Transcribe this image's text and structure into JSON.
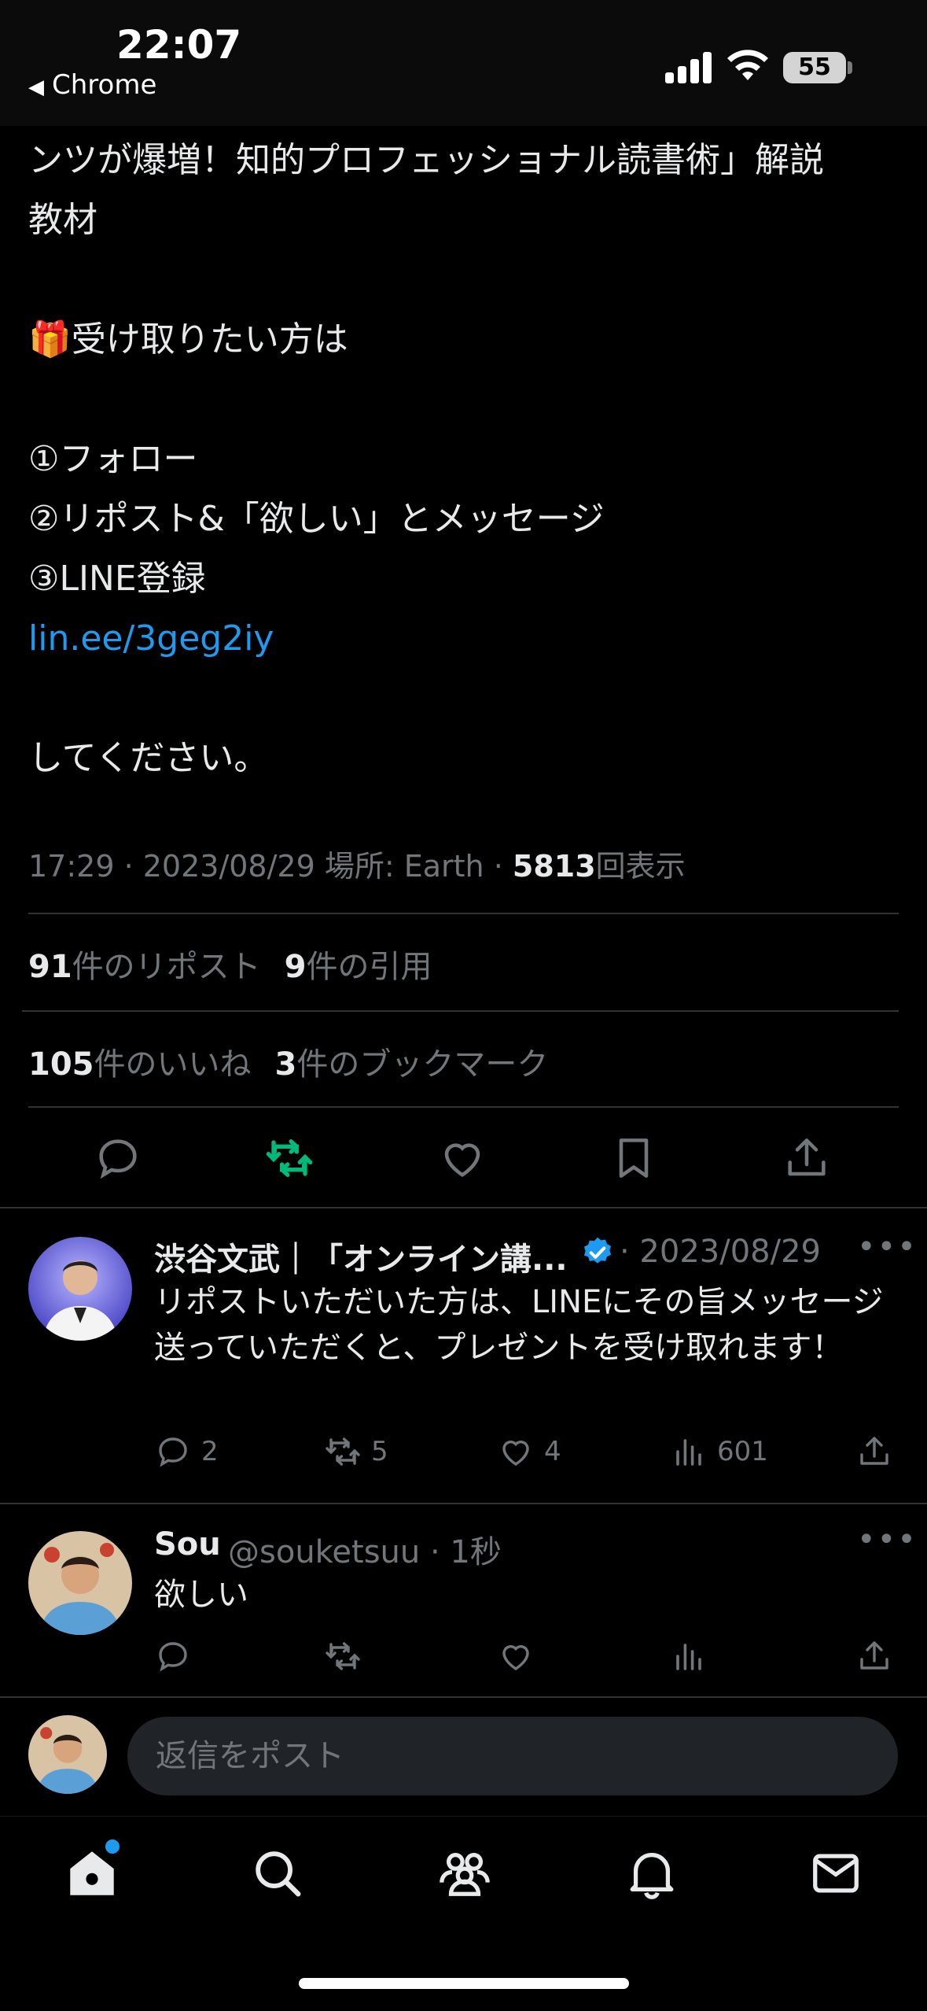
{
  "status_bar": {
    "time": "22:07",
    "back_app": "Chrome",
    "battery": "55"
  },
  "tweet": {
    "lines": [
      "ンツが爆増！知的プロフェッショナル読書術」解説",
      "教材",
      "",
      "受け取りたい方は",
      "",
      "①フォロー",
      "②リポスト&「欲しい」とメッセージ",
      "③LINE登録"
    ],
    "link": "lin.ee/3geg2iy",
    "closing": "してください。",
    "gift_emoji": "🎁",
    "meta_time": "17:29 · 2023/08/29 場所: Earth · ",
    "views_count": "5813",
    "views_label": "回表示",
    "reposts_count": "91",
    "reposts_label": "件のリポスト",
    "quotes_count": "9",
    "quotes_label": "件の引用",
    "likes_count": "105",
    "likes_label": "件のいいね",
    "bookmarks_count": "3",
    "bookmarks_label": "件のブックマーク"
  },
  "replies": [
    {
      "name": "渋谷文武｜「オンライン講...",
      "verified": true,
      "sub": "· 2023/08/29",
      "text": "リポストいただいた方は、LINEにその旨メッセージ送っていただくと、プレゼントを受け取れます！",
      "replies": "2",
      "reposts": "5",
      "likes": "4",
      "views": "601"
    },
    {
      "name": "Sou",
      "verified": false,
      "sub": "@souketsuu · 1秒",
      "text": "欲しい",
      "replies": "",
      "reposts": "",
      "likes": "",
      "views": ""
    }
  ],
  "reply_bar": {
    "placeholder": "返信をポスト"
  },
  "colors": {
    "accent": "#1d9bf0",
    "repost_active": "#00ba7c",
    "muted": "#71767b"
  },
  "icons": [
    "reply-icon",
    "repost-icon",
    "like-icon",
    "bookmark-icon",
    "share-icon",
    "views-icon",
    "home-icon",
    "search-icon",
    "communities-icon",
    "notifications-icon",
    "messages-icon",
    "verified-icon"
  ]
}
